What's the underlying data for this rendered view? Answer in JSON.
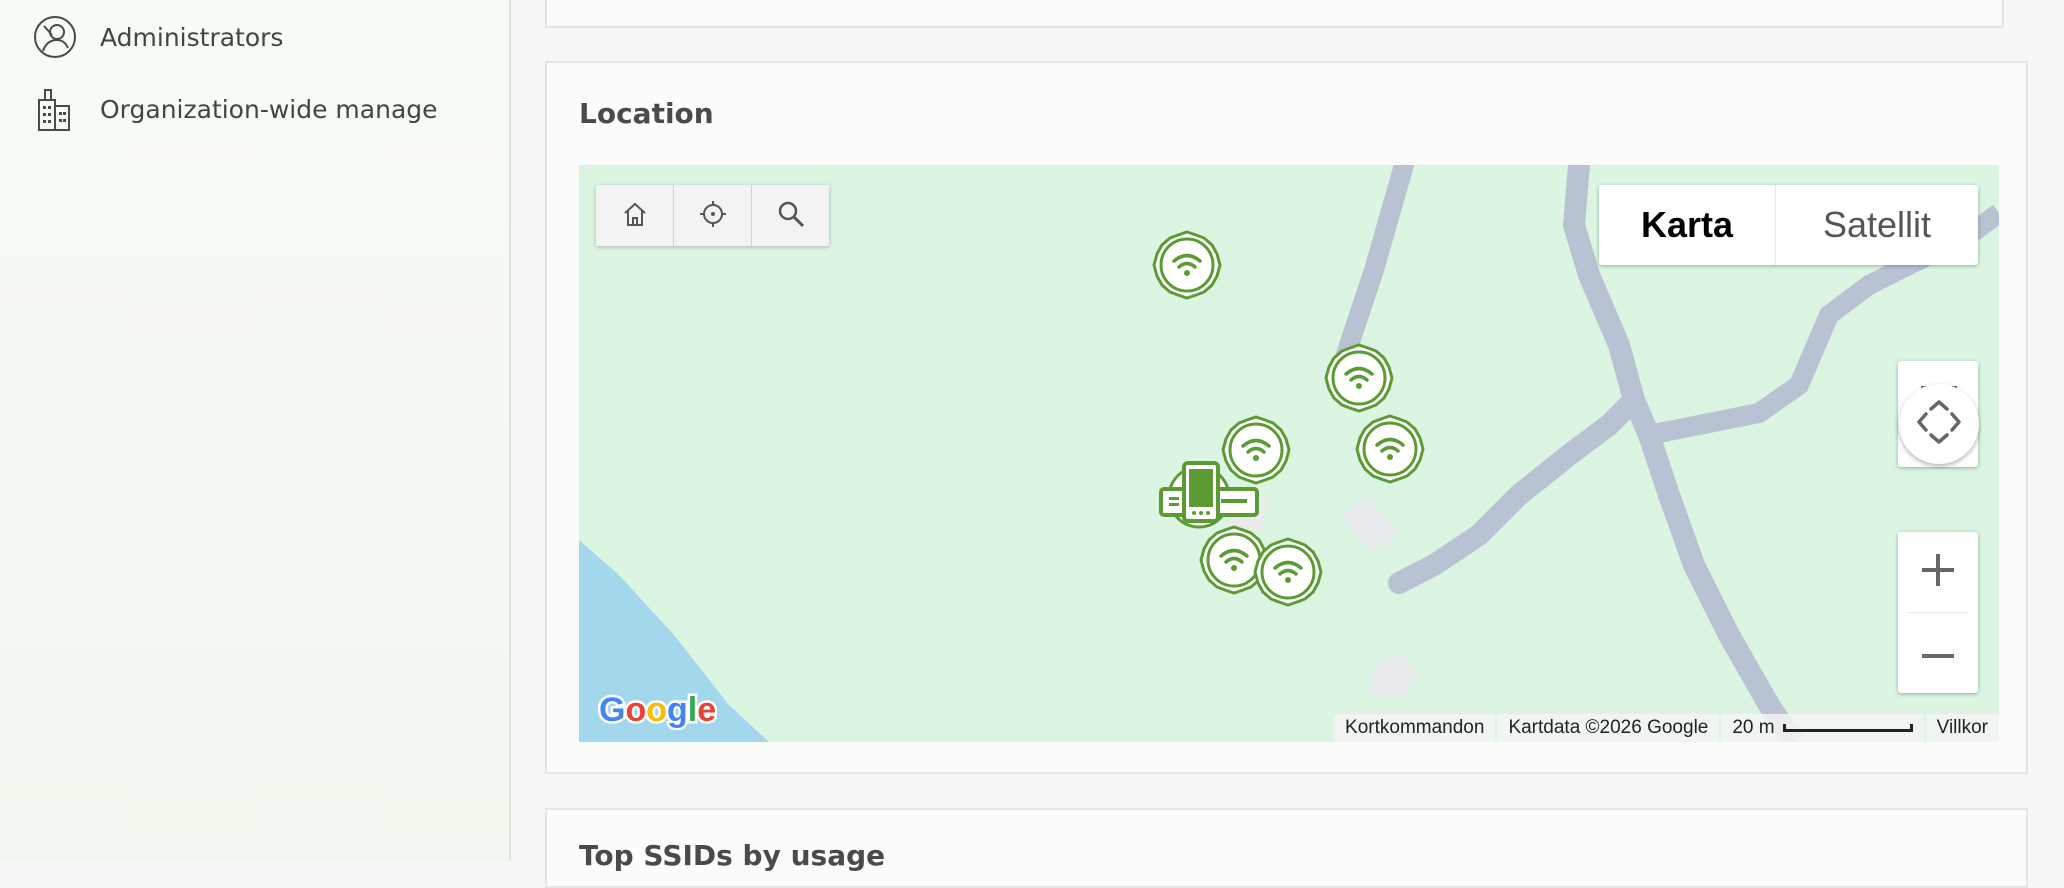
{
  "sidebar": {
    "items": [
      {
        "label": "Administrators",
        "icon": "admin-user-icon"
      },
      {
        "label": "Organization-wide manage",
        "icon": "building-icon"
      }
    ]
  },
  "location": {
    "title": "Location",
    "map": {
      "toolbar": {
        "home_icon": "home-icon",
        "locate_icon": "crosshair-icon",
        "search_icon": "search-icon"
      },
      "map_types": {
        "active": "Karta",
        "inactive": "Satellit"
      },
      "zoom": {
        "in": "+",
        "out": "−"
      },
      "attribution": {
        "shortcuts": "Kortkommandon",
        "data": "Kartdata ©2026 Google",
        "scale": "20 m",
        "terms": "Villkor"
      },
      "logo": "Google",
      "colors": {
        "land": "#dcf5e2",
        "road": "#b9c2d2",
        "water": "#a3d8ec",
        "marker": "#5c9b34"
      }
    }
  },
  "top_ssids": {
    "title": "Top SSIDs by usage"
  }
}
